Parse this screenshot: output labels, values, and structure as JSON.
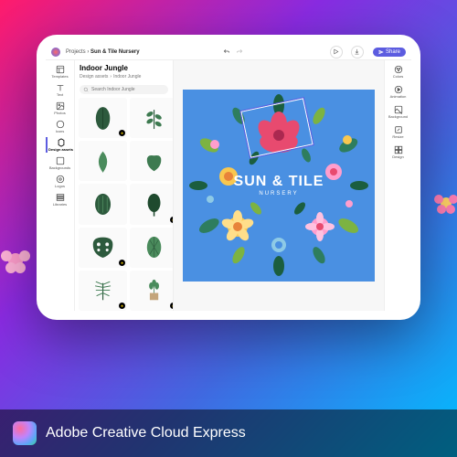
{
  "breadcrumb": {
    "root": "Projects",
    "current": "Sun & Tile Nursery"
  },
  "toolbar": {
    "share_label": "Share"
  },
  "left_rail": {
    "items": [
      {
        "label": "Templates"
      },
      {
        "label": "Text"
      },
      {
        "label": "Photos"
      },
      {
        "label": "Icons"
      },
      {
        "label": "Design assets"
      },
      {
        "label": "Backgrounds"
      },
      {
        "label": "Logos"
      },
      {
        "label": "Libraries"
      }
    ]
  },
  "assets_panel": {
    "title": "Indoor Jungle",
    "crumb_root": "Design assets",
    "crumb_current": "Indoor Jungle",
    "search_placeholder": "Search Indoor Jungle",
    "items": [
      {
        "kind": "leaf-broad",
        "premium": true
      },
      {
        "kind": "leaf-branch",
        "premium": false
      },
      {
        "kind": "leaf-simple",
        "premium": false
      },
      {
        "kind": "leaf-heart",
        "premium": false
      },
      {
        "kind": "leaf-calathea",
        "premium": false
      },
      {
        "kind": "leaf-rubber",
        "premium": true
      },
      {
        "kind": "monstera",
        "premium": true
      },
      {
        "kind": "leaf-striped",
        "premium": false
      },
      {
        "kind": "leaf-palm-small",
        "premium": true
      },
      {
        "kind": "pot-plant",
        "premium": true
      }
    ]
  },
  "canvas": {
    "brand_main": "SUN & TILE",
    "brand_sub": "NURSERY",
    "bg_color": "#4a90e2"
  },
  "right_rail": {
    "items": [
      {
        "label": "Colors"
      },
      {
        "label": "Animation"
      },
      {
        "label": "Background"
      },
      {
        "label": "Resize"
      },
      {
        "label": "Design"
      }
    ]
  },
  "brand_bar": {
    "product_name": "Adobe Creative Cloud Express"
  }
}
